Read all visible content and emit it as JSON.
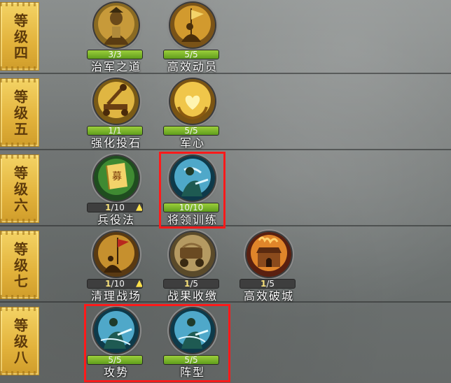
{
  "tiers": [
    {
      "label": "等级四",
      "skills": [
        {
          "name": "治军之道",
          "current": "3",
          "max": "3",
          "fill": 1.0,
          "icon": "general-armor-icon",
          "up": false
        },
        {
          "name": "高效动员",
          "current": "5",
          "max": "5",
          "fill": 1.0,
          "icon": "banner-horseman-icon",
          "up": false
        }
      ]
    },
    {
      "label": "等级五",
      "skills": [
        {
          "name": "强化投石",
          "current": "1",
          "max": "1",
          "fill": 1.0,
          "icon": "catapult-icon",
          "up": false
        },
        {
          "name": "军心",
          "current": "5",
          "max": "5",
          "fill": 1.0,
          "icon": "heart-hands-icon",
          "up": false
        }
      ]
    },
    {
      "label": "等级六",
      "skills": [
        {
          "name": "兵役法",
          "current": "1",
          "max": "10",
          "fill": 0.0,
          "icon": "recruit-scroll-icon",
          "up": true
        },
        {
          "name": "将领训练",
          "current": "10",
          "max": "10",
          "fill": 1.0,
          "icon": "commander-training-icon",
          "up": false
        }
      ]
    },
    {
      "label": "等级七",
      "skills": [
        {
          "name": "清理战场",
          "current": "1",
          "max": "10",
          "fill": 0.0,
          "icon": "battlefield-flag-icon",
          "up": true
        },
        {
          "name": "战果收缴",
          "current": "1",
          "max": "5",
          "fill": 0.0,
          "icon": "war-cart-icon",
          "up": false
        },
        {
          "name": "高效破城",
          "current": "1",
          "max": "5",
          "fill": 0.0,
          "icon": "burning-city-icon",
          "up": false
        }
      ]
    },
    {
      "label": "等级八",
      "skills": [
        {
          "name": "攻势",
          "current": "5",
          "max": "5",
          "fill": 1.0,
          "icon": "commander-attack-icon",
          "up": false
        },
        {
          "name": "阵型",
          "current": "5",
          "max": "5",
          "fill": 1.0,
          "icon": "commander-formation-icon",
          "up": false
        }
      ]
    }
  ],
  "colors": {
    "highlight": "#ff1a1a",
    "bar_fill": "#7cb82a",
    "tier_gold": "#e2b23b"
  }
}
